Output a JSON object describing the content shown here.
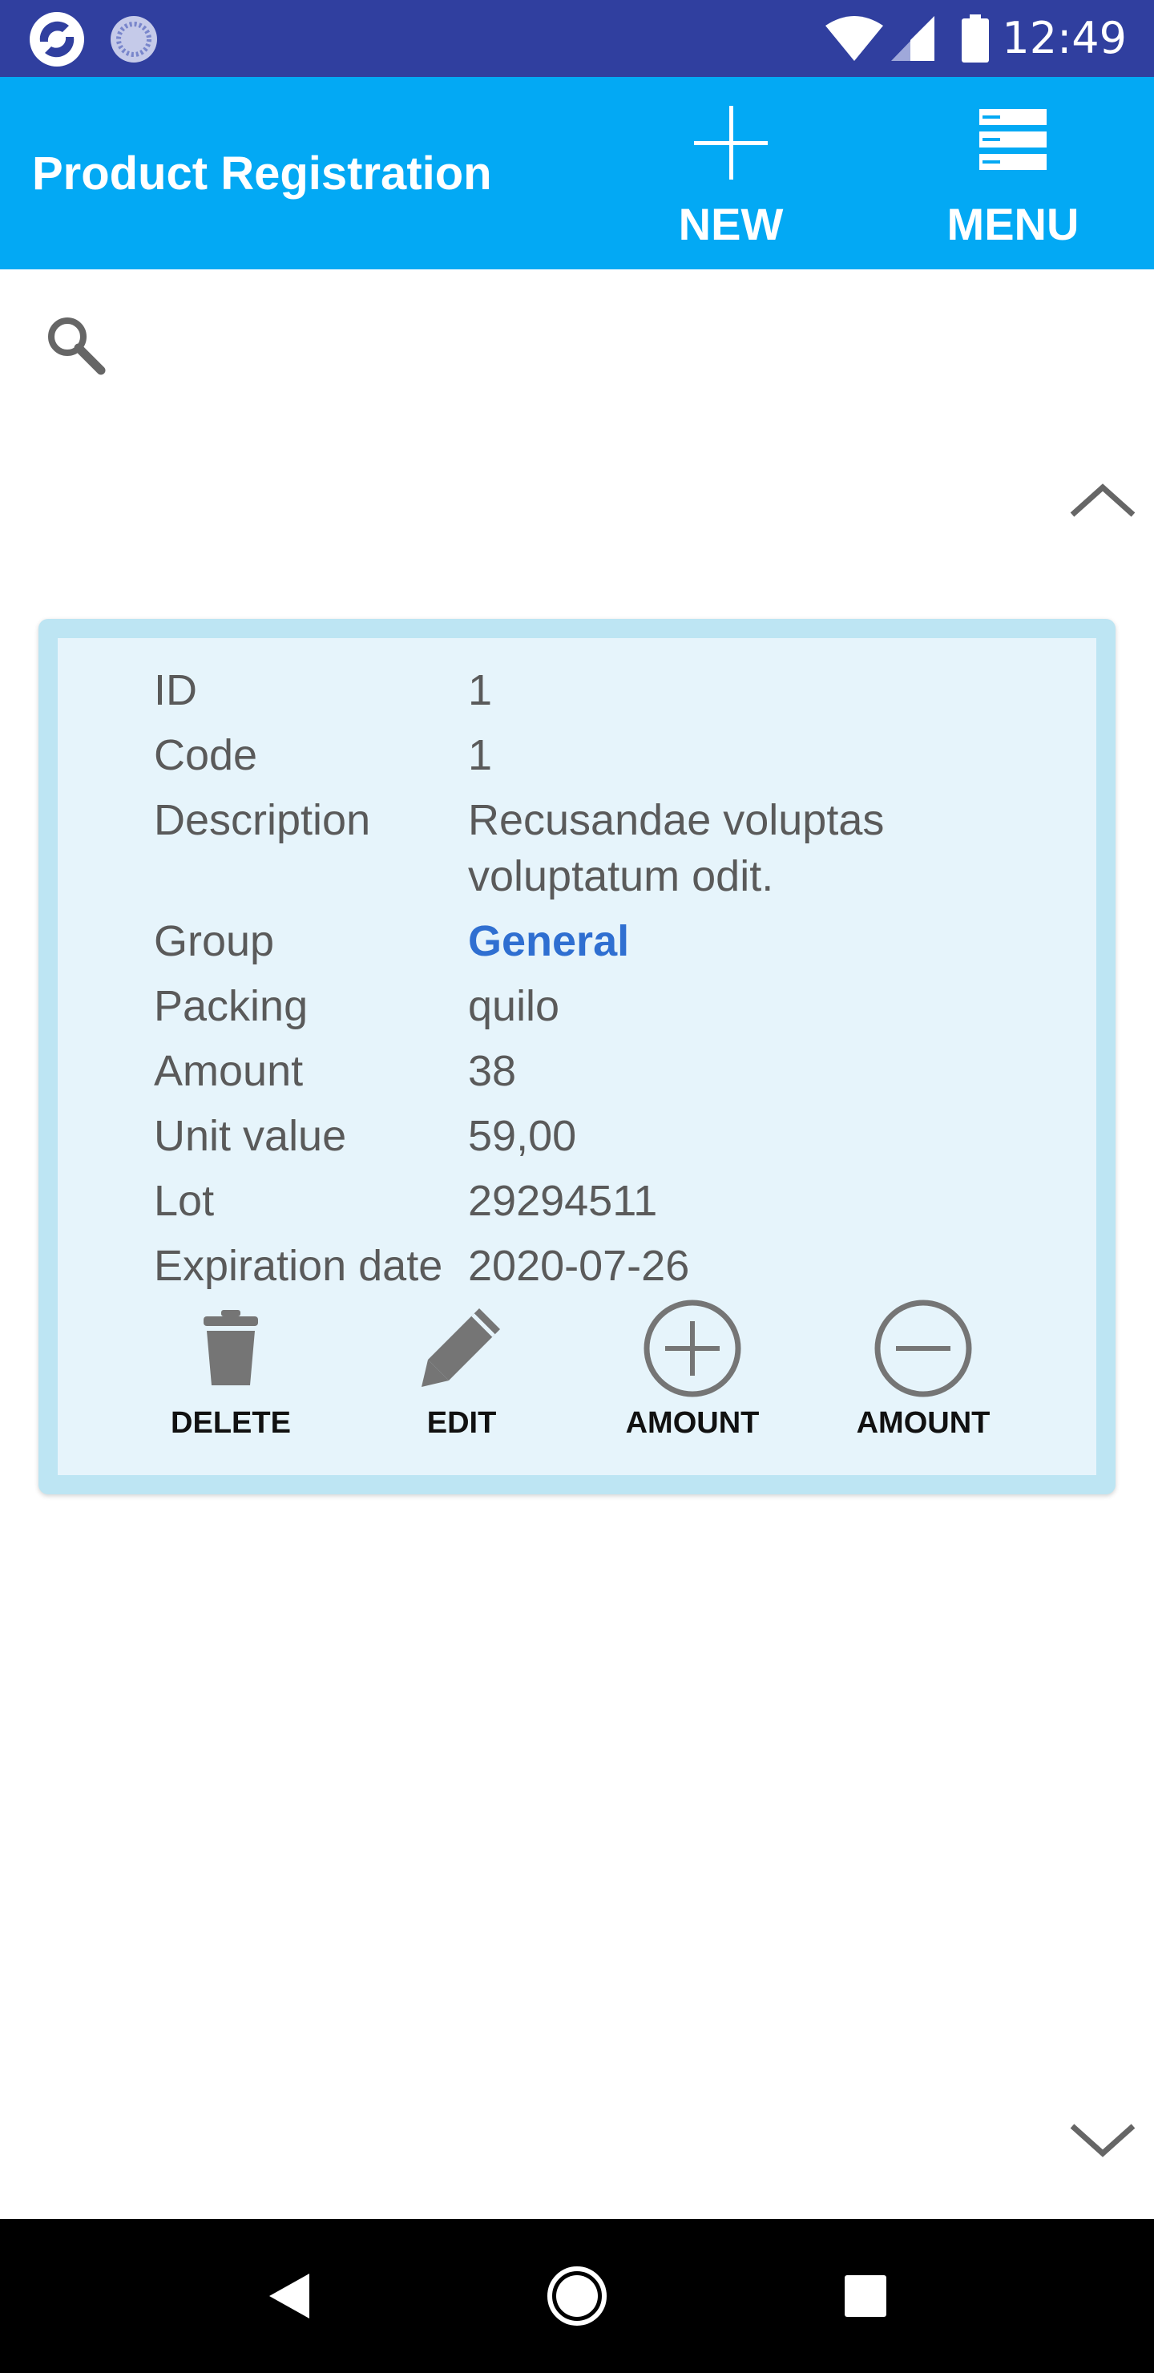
{
  "status_bar": {
    "time": "12:49"
  },
  "app_bar": {
    "title": "Product Registration",
    "new_label": "NEW",
    "menu_label": "MENU"
  },
  "search": {
    "placeholder": ""
  },
  "product": {
    "fields": [
      {
        "label": "ID",
        "value": "1"
      },
      {
        "label": "Code",
        "value": "1"
      },
      {
        "label": "Description",
        "value": "Recusandae voluptas voluptatum odit."
      },
      {
        "label": "Group",
        "value": "General"
      },
      {
        "label": "Packing",
        "value": "quilo"
      },
      {
        "label": "Amount",
        "value": "38"
      },
      {
        "label": "Unit value",
        "value": "59,00"
      },
      {
        "label": "Lot",
        "value": "29294511"
      },
      {
        "label": "Expiration date",
        "value": "2020-07-26"
      }
    ],
    "actions": [
      {
        "label": "DELETE",
        "icon": "trash-icon"
      },
      {
        "label": "EDIT",
        "icon": "pencil-icon"
      },
      {
        "label": "AMOUNT",
        "icon": "plus-circle-icon"
      },
      {
        "label": "AMOUNT",
        "icon": "minus-circle-icon"
      }
    ]
  },
  "colors": {
    "status_bar": "#303F9F",
    "app_bar": "#03A9F4",
    "card_border": "#BDE5F3",
    "card_bg": "#E6F4FB",
    "link": "#2F6FD1"
  }
}
